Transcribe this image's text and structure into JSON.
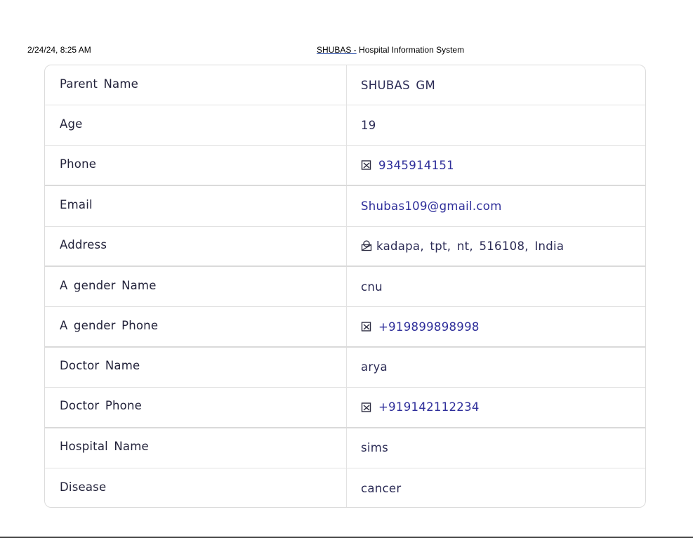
{
  "print_header": {
    "date": "2/24/24, 8:25 AM",
    "title_link": "SHUBAS  -",
    "title_rest": " Hospital Information System"
  },
  "rows": [
    {
      "label": "Parent  Name",
      "value": "SHUBAS  GM",
      "icon": "",
      "link": false
    },
    {
      "label": "Age",
      "value": "19",
      "icon": "",
      "link": false
    },
    {
      "label": "Phone",
      "value": "9345914151",
      "icon": "phone-icon",
      "link": true
    },
    {
      "label": "Email",
      "value": "Shubas109@gmail.com",
      "icon": "",
      "link": true
    },
    {
      "label": "Address",
      "value": "kadapa,  tpt,  nt,  516108,  India",
      "icon": "location-icon",
      "link": false
    },
    {
      "label": "A gender  Name",
      "value": "cnu",
      "icon": "",
      "link": false
    },
    {
      "label": "A gender  Phone",
      "value": "+919899898998",
      "icon": "phone-icon",
      "link": true
    },
    {
      "label": "Doctor  Name",
      "value": "arya",
      "icon": "",
      "link": false
    },
    {
      "label": "Doctor  Phone",
      "value": "+919142112234",
      "icon": "phone-icon",
      "link": true
    },
    {
      "label": "Hospital  Name",
      "value": "sims",
      "icon": "",
      "link": false
    },
    {
      "label": "Disease",
      "value": "cancer",
      "icon": "",
      "link": false
    }
  ],
  "colors": {
    "link": "#2e2e9a",
    "text": "#22223a",
    "border": "#e2e2e2"
  }
}
